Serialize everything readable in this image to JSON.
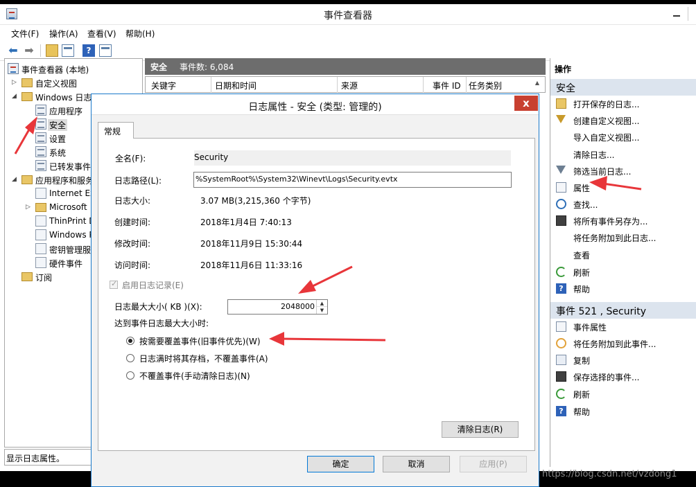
{
  "window": {
    "title": "事件查看器"
  },
  "menu": [
    "文件(F)",
    "操作(A)",
    "查看(V)",
    "帮助(H)"
  ],
  "toolbar": {
    "buttons": [
      "back-arrow-icon",
      "forward-arrow-icon",
      "folder-up-icon",
      "show-pane-icon",
      "help-icon",
      "action-pane-icon"
    ]
  },
  "tree": {
    "root": "事件查看器 (本地)",
    "custom_views": "自定义视图",
    "windows_logs": "Windows 日志",
    "app": "应用程序",
    "security": "安全",
    "setup": "设置",
    "system": "系统",
    "forwarded": "已转发事件",
    "apps_services": "应用程序和服务",
    "ie": "Internet Ex",
    "microsoft": "Microsoft",
    "thinprint": "ThinPrint D",
    "windows_p": "Windows P",
    "key_mgmt": "密钥管理服",
    "hardware": "硬件事件",
    "subscriptions": "订阅"
  },
  "middle": {
    "title": "安全",
    "count": "事件数: 6,084",
    "columns": [
      "关键字",
      "日期和时间",
      "来源",
      "事件 ID",
      "任务类别"
    ]
  },
  "actions": {
    "header": "操作",
    "section1": "安全",
    "items1": [
      "打开保存的日志...",
      "创建自定义视图...",
      "导入自定义视图...",
      "清除日志...",
      "筛选当前日志...",
      "属性",
      "查找...",
      "将所有事件另存为...",
      "将任务附加到此日志...",
      "查看",
      "刷新",
      "帮助"
    ],
    "section2": "事件 521 , Security",
    "items2": [
      "事件属性",
      "将任务附加到此事件...",
      "复制",
      "保存选择的事件...",
      "刷新",
      "帮助"
    ]
  },
  "status": "显示日志属性。",
  "dialog": {
    "title": "日志属性 - 安全 (类型: 管理的)",
    "close": "x",
    "tab": "常规",
    "full_name_label": "全名(F):",
    "full_name_value": "Security",
    "path_label": "日志路径(L):",
    "path_value": "%SystemRoot%\\System32\\Winevt\\Logs\\Security.evtx",
    "size_label": "日志大小:",
    "size_value": "3.07 MB(3,215,360 个字节)",
    "created_label": "创建时间:",
    "created_value": "2018年1月4日 7:40:13",
    "modified_label": "修改时间:",
    "modified_value": "2018年11月9日 15:30:44",
    "accessed_label": "访问时间:",
    "accessed_value": "2018年11月6日 11:33:16",
    "enable_logging": "启用日志记录(E)",
    "max_size_label": "日志最大大小( KB )(X):",
    "max_size_value": "2048000",
    "when_max_label": "达到事件日志最大大小时:",
    "radio_overwrite": "按需要覆盖事件(旧事件优先)(W)",
    "radio_archive": "日志满时将其存档，不覆盖事件(A)",
    "radio_manual": "不覆盖事件(手动清除日志)(N)",
    "clear_log": "清除日志(R)",
    "ok": "确定",
    "cancel": "取消",
    "apply": "应用(P)"
  },
  "watermark": "https://blog.csdn.net/vzdong1",
  "colors": {
    "annotation": "#e8363a",
    "section_bg": "#dce4ee",
    "dialog_border": "#1979ca"
  }
}
